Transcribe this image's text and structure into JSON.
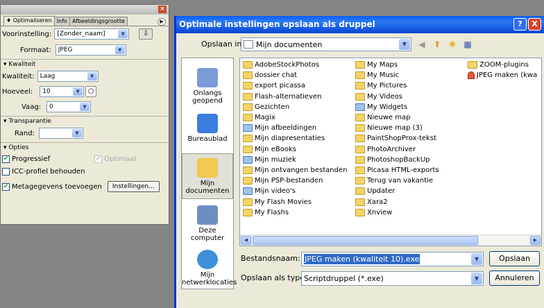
{
  "palette": {
    "tabs": [
      "♦ Optimaliseren",
      "Info",
      "Afbeeldingsgrootte"
    ],
    "preset_label": "Voorinstelling:",
    "preset_value": "[Zonder_naam]",
    "format_label": "Formaat:",
    "format_value": "JPEG",
    "quality_section": "Kwaliteit",
    "quality_label": "Kwaliteit:",
    "quality_value": "Laag",
    "amount_label": "Hoeveel:",
    "amount_value": "10",
    "blur_label": "Vaag:",
    "blur_value": "0",
    "transparency_section": "Transparantie",
    "matte_label": "Rand:",
    "matte_value": "",
    "options_section": "Opties",
    "progressive_label": "Progressief",
    "optimized_label": "Optimaal",
    "icc_label": "ICC-profiel behouden",
    "metadata_label": "Metagegevens toevoegen",
    "settings_button": "Instellingen..."
  },
  "dialog": {
    "title": "Optimale instellingen opslaan als druppel",
    "help_label": "?",
    "close_label": "X",
    "look_in_label": "Opslaan in:",
    "look_in_value": "Mijn documenten",
    "places": [
      "Onlangs geopend",
      "Bureaublad",
      "Mijn documenten",
      "Deze computer",
      "Mijn netwerklocaties"
    ],
    "files_col1": [
      "AdobeStockPhotos",
      "dossier chat",
      "export picassa",
      "Flash-alternatieven",
      "Gezichten",
      "Magix",
      "Mijn afbeeldingen",
      "Mijn diapresentaties",
      "Mijn eBooks",
      "Mijn muziek",
      "Mijn ontvangen bestanden",
      "Mijn PSP-bestanden",
      "Mijn video's",
      "My Flash Movies",
      "My Flashs"
    ],
    "files_col2": [
      "My Maps",
      "My Music",
      "My Pictures",
      "My Videos",
      "My Widgets",
      "Nieuwe map",
      "Nieuwe map (3)",
      "PaintShopProx-tekst",
      "PhotoArchiver",
      "PhotoshopBackUp",
      "Picasa HTML-exports",
      "Terug van vakantie",
      "Updater",
      "Xara2",
      "Xnview"
    ],
    "files_col3": [
      "ZOOM-plugins",
      "JPEG maken (kwa"
    ],
    "filename_label": "Bestandsnaam:",
    "filename_value": "JPEG maken (kwaliteit 10).exe",
    "filetype_label": "Opslaan als type:",
    "filetype_value": "Scriptdruppel (*.exe)",
    "save_button": "Opslaan",
    "cancel_button": "Annuleren"
  },
  "colors": {
    "titlebar": "#0a5cf1",
    "selection": "#316ac5",
    "folder": "#f4d467",
    "close": "#d9442a"
  }
}
